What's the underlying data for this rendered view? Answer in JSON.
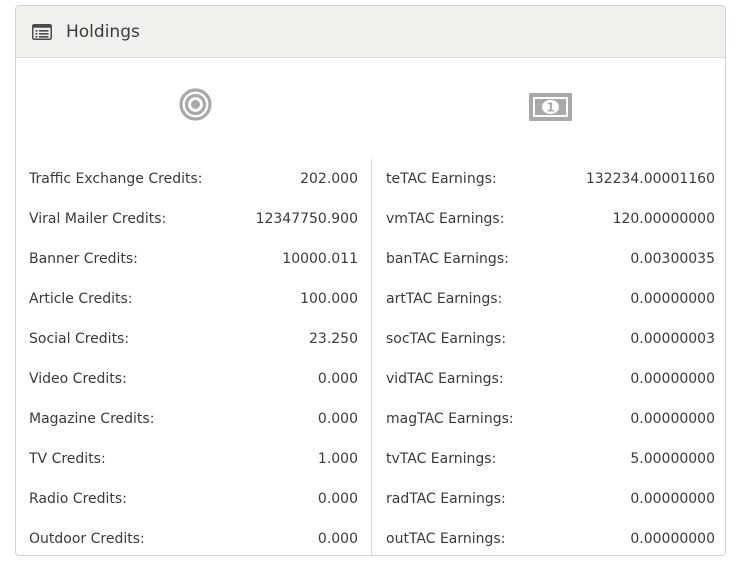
{
  "panel": {
    "title": "Holdings",
    "header_icon": "list-icon",
    "left_icon": "target-icon",
    "right_icon": "money-bill-icon"
  },
  "credits": [
    {
      "label": "Traffic Exchange Credits:",
      "value": "202.000"
    },
    {
      "label": "Viral Mailer Credits:",
      "value": "12347750.900"
    },
    {
      "label": "Banner Credits:",
      "value": "10000.011"
    },
    {
      "label": "Article Credits:",
      "value": "100.000"
    },
    {
      "label": "Social Credits:",
      "value": "23.250"
    },
    {
      "label": "Video Credits:",
      "value": "0.000"
    },
    {
      "label": "Magazine Credits:",
      "value": "0.000"
    },
    {
      "label": "TV Credits:",
      "value": "1.000"
    },
    {
      "label": "Radio Credits:",
      "value": "0.000"
    },
    {
      "label": "Outdoor Credits:",
      "value": "0.000"
    }
  ],
  "earnings": [
    {
      "label": "teTAC Earnings:",
      "value": "132234.00001160"
    },
    {
      "label": "vmTAC Earnings:",
      "value": "120.00000000"
    },
    {
      "label": "banTAC Earnings:",
      "value": "0.00300035"
    },
    {
      "label": "artTAC Earnings:",
      "value": "0.00000000"
    },
    {
      "label": "socTAC Earnings:",
      "value": "0.00000003"
    },
    {
      "label": "vidTAC Earnings:",
      "value": "0.00000000"
    },
    {
      "label": "magTAC Earnings:",
      "value": "0.00000000"
    },
    {
      "label": "tvTAC Earnings:",
      "value": "5.00000000"
    },
    {
      "label": "radTAC Earnings:",
      "value": "0.00000000"
    },
    {
      "label": "outTAC Earnings:",
      "value": "0.00000000"
    }
  ]
}
